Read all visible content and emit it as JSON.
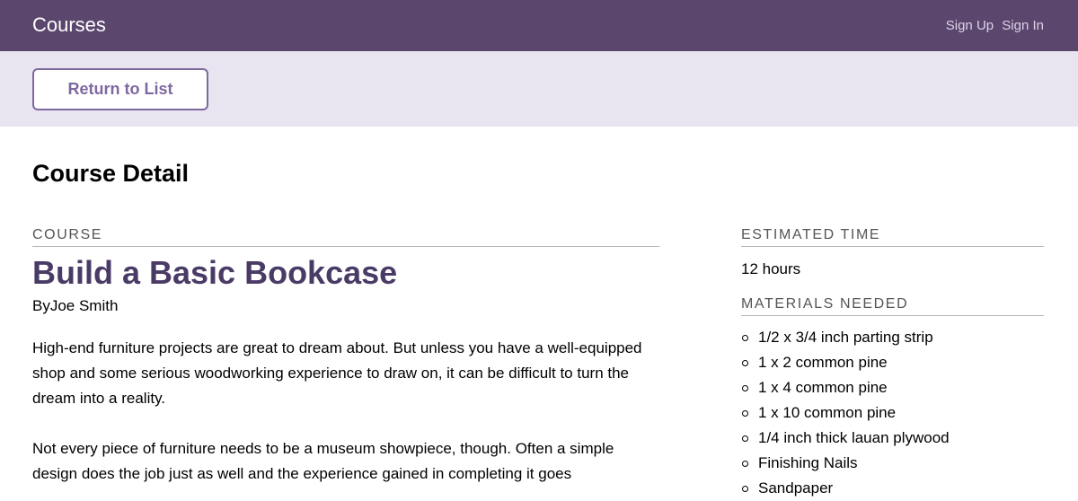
{
  "header": {
    "brand": "Courses",
    "sign_up": "Sign Up",
    "sign_in": "Sign In",
    "colors": {
      "bar": "#5b476e",
      "brand_text": "#ffffff",
      "link_text": "#dcd3e8"
    }
  },
  "actionbar": {
    "return_label": "Return to List",
    "colors": {
      "bar": "#e8e5f1",
      "button_accent": "#7e68a0"
    }
  },
  "page": {
    "title": "Course Detail"
  },
  "course": {
    "section_label": "COURSE",
    "title": "Build a Basic Bookcase",
    "author": "ByJoe Smith",
    "description": [
      "High-end furniture projects are great to dream about. But unless you have a well-equipped shop and some serious woodworking experience to draw on, it can be difficult to turn the dream into a reality.",
      "Not every piece of furniture needs to be a museum showpiece, though. Often a simple design does the job just as well and the experience gained in completing it goes"
    ],
    "title_color": "#4a3b66"
  },
  "sidebar": {
    "estimated_time_label": "ESTIMATED TIME",
    "estimated_time": "12 hours",
    "materials_label": "MATERIALS NEEDED",
    "materials": [
      "1/2 x 3/4 inch parting strip",
      "1 x 2 common pine",
      "1 x 4 common pine",
      "1 x 10 common pine",
      "1/4 inch thick lauan plywood",
      "Finishing Nails",
      "Sandpaper"
    ]
  }
}
